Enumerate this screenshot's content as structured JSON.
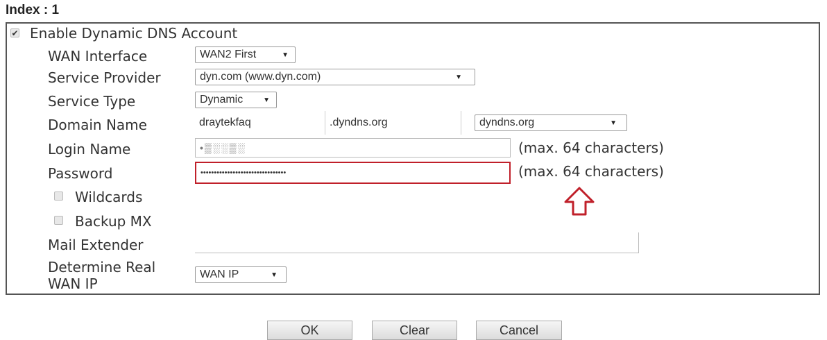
{
  "index_title": "Index : 1",
  "enable": {
    "label": "Enable Dynamic DNS Account",
    "checked": true
  },
  "wan_interface": {
    "label": "WAN Interface",
    "value": "WAN2 First"
  },
  "service_provider": {
    "label": "Service Provider",
    "value": "dyn.com (www.dyn.com)"
  },
  "service_type": {
    "label": "Service Type",
    "value": "Dynamic"
  },
  "domain_name": {
    "label": "Domain Name",
    "host": "draytekfaq",
    "suffix": ".dyndns.org",
    "dropdown": "dyndns.org"
  },
  "login_name": {
    "label": "Login Name",
    "value": "•▒░░▒░",
    "note": "(max. 64 characters)"
  },
  "password": {
    "label": "Password",
    "value": "••••••••••••••••••••••••••••••••",
    "note": "(max. 64 characters)"
  },
  "wildcards": {
    "label": "Wildcards",
    "checked": false
  },
  "backup_mx": {
    "label": "Backup MX",
    "checked": false
  },
  "mail_extender": {
    "label": "Mail Extender",
    "value": ""
  },
  "determine_real_wan_ip": {
    "label_line1": "Determine Real",
    "label_line2": "WAN IP",
    "value": "WAN IP"
  },
  "buttons": {
    "ok": "OK",
    "clear": "Clear",
    "cancel": "Cancel"
  },
  "annotation": {
    "color": "#c0202a",
    "icon": "arrow-up-outline-icon"
  },
  "icons": {
    "dropdown": "dropdown-arrow-icon",
    "check": "checkmark-icon"
  }
}
